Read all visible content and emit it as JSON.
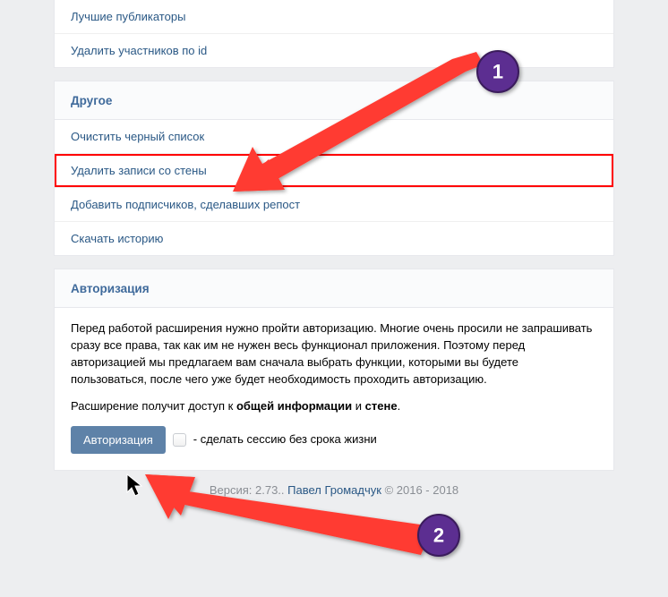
{
  "top_items": [
    "Лучшие публикаторы",
    "Удалить участников по id"
  ],
  "other": {
    "title": "Другое",
    "items": [
      "Очистить черный список",
      "Удалить записи со стены",
      "Добавить подписчиков, сделавших репост",
      "Скачать историю"
    ],
    "highlight_index": 1
  },
  "auth": {
    "title": "Авторизация",
    "paragraph": "Перед работой расширения нужно пройти авторизацию. Многие очень просили не запрашивать сразу все права, так как им не нужен весь функционал приложения. Поэтому перед авторизацией мы предлагаем вам сначала выбрать функции, которыми вы будете пользоваться, после чего уже будет необходимость проходить авторизацию.",
    "access_prefix": "Расширение получит доступ к ",
    "access_bold_1": "общей информации",
    "access_mid": " и ",
    "access_bold_2": "стене",
    "access_suffix": ".",
    "button": "Авторизация",
    "checkbox_label": "- сделать сессию без срока жизни"
  },
  "footer": {
    "prefix": "Версия: 2.73.. ",
    "author": "Павел Громадчук",
    "suffix": " © 2016 - 2018"
  },
  "annotations": {
    "step1": "1",
    "step2": "2"
  }
}
